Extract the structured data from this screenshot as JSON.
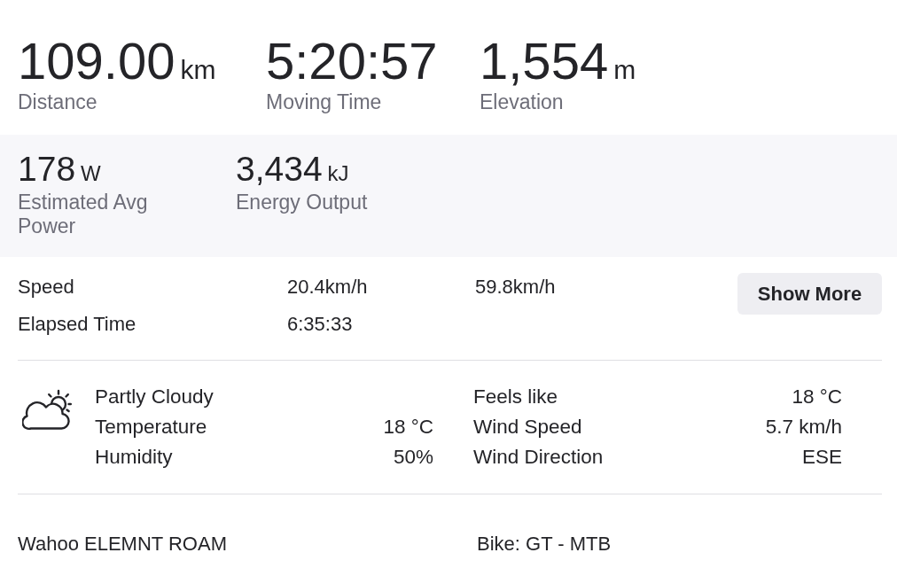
{
  "summary_stats": [
    {
      "value": "109.00",
      "unit": "km",
      "label": "Distance"
    },
    {
      "value": "5:20:57",
      "label": "Moving Time"
    },
    {
      "value": "1,554",
      "unit": "m",
      "label": "Elevation"
    }
  ],
  "power_stats": [
    {
      "value": "178",
      "unit": "W",
      "label": "Estimated Avg Power"
    },
    {
      "value": "3,434",
      "unit": "kJ",
      "label": "Energy Output"
    }
  ],
  "detail_rows": [
    {
      "label": "Speed",
      "values": [
        "20.4km/h",
        "59.8km/h"
      ]
    },
    {
      "label": "Elapsed Time",
      "values": [
        "6:35:33"
      ]
    }
  ],
  "show_more_button": "Show More",
  "weather": {
    "condition": "Partly Cloudy",
    "left_rows": [
      {
        "label": "Temperature",
        "value": "18 °C"
      },
      {
        "label": "Humidity",
        "value": "50%"
      }
    ],
    "right_rows": [
      {
        "label": "Feels like",
        "value": "18 °C"
      },
      {
        "label": "Wind Speed",
        "value": "5.7 km/h"
      },
      {
        "label": "Wind Direction",
        "value": "ESE"
      }
    ]
  },
  "footer": {
    "device": "Wahoo ELEMNT ROAM",
    "bike": "Bike: GT - MTB"
  }
}
